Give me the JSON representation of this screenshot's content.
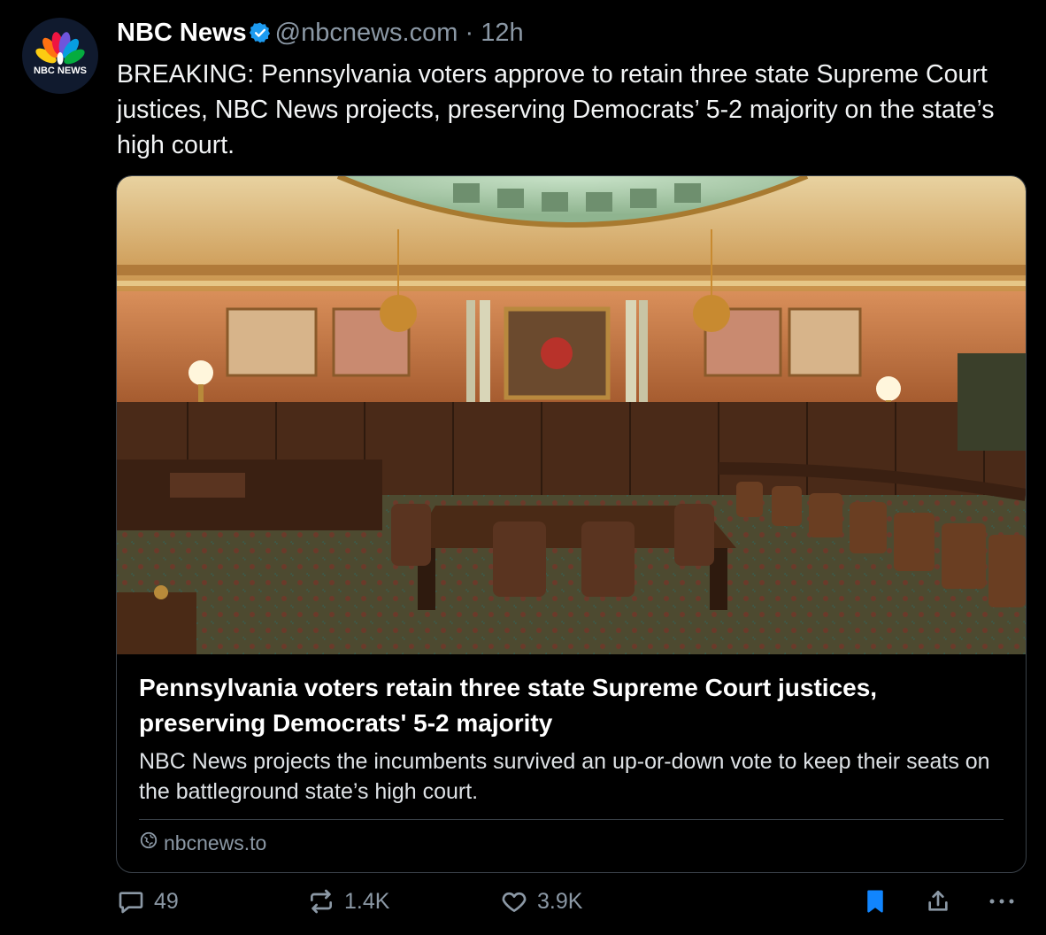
{
  "post": {
    "author_name": "NBC News",
    "handle": "@nbcnews.com",
    "separator": "·",
    "time": "12h",
    "avatar_text": "NBC NEWS",
    "text": "BREAKING: Pennsylvania voters approve to retain three state Supreme Court justices, NBC News projects, preserving Democrats’ 5-2 majority on the state’s high court."
  },
  "card": {
    "title": "Pennsylvania voters retain three state Supreme Court justices, preserving Democrats' 5-2 majority",
    "description": "NBC News projects the incumbents survived an up-or-down vote to keep their seats on the battleground state’s high court.",
    "domain": "nbcnews.to"
  },
  "actions": {
    "replies": "49",
    "reposts": "1.4K",
    "likes": "3.9K"
  },
  "colors": {
    "background": "#000000",
    "text": "#ffffff",
    "muted": "#8b98a5",
    "border": "#3a4149",
    "verified": "#1d9bf0",
    "bookmark_active": "#1185fe"
  },
  "icons": [
    "nbc-peacock-logo",
    "verified-badge-icon",
    "globe-icon",
    "reply-icon",
    "repost-icon",
    "like-icon",
    "bookmark-icon",
    "share-icon",
    "more-icon"
  ]
}
